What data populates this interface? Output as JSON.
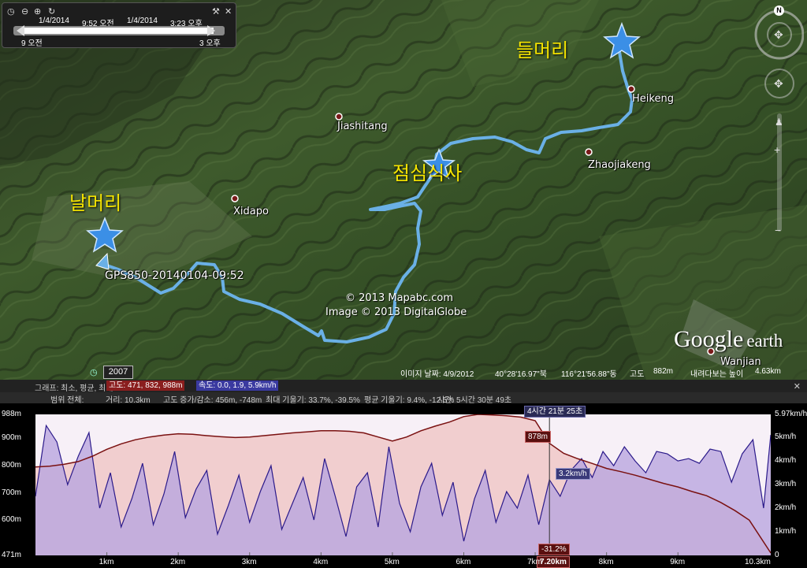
{
  "map": {
    "places": [
      "Jiashitang",
      "Heikeng",
      "Zhaojiakeng",
      "Xidapo",
      "Wanjian"
    ],
    "korean_labels": {
      "start": "날머리",
      "lunch": "점심식사",
      "end": "들머리"
    },
    "track_name": "GPS850-20140104-09:52",
    "copyright_1": "© 2013 Mapabc.com",
    "copyright_2": "Image © 2013 DigitalGlobe",
    "logo_google": "Google",
    "logo_earth": "earth",
    "compass_north": "N"
  },
  "timebar": {
    "start_date": "1/4/2014",
    "start_time": "9:52 오전",
    "end_date": "1/4/2014",
    "end_time": "3:23 오후",
    "left_label": "9 오전",
    "right_label": "3 오후"
  },
  "statusbar": {
    "year": "2007",
    "image_date": "이미지 날짜: 4/9/2012",
    "lat": "40°28'16.97\"북",
    "lon": "116°21'56.88\"동",
    "elev_label": "고도",
    "elev_value": "882m",
    "eye_label": "내려다보는 높이",
    "eye_value": "4.63km"
  },
  "profile": {
    "header1_label": "그래프: 최소, 평균, 최대",
    "header1_elev": "고도: 471, 832, 988m",
    "header1_speed": "속도: 0.0, 1.9, 5.9km/h",
    "header2_range": "범위 전체:",
    "header2_dist": "거리: 10.3km",
    "header2_gain": "고도 증가/감소: 456m, -748m",
    "header2_slope_max": "최대 기울기: 33.7%, -39.5%",
    "header2_slope_avg": "평균 기울기: 9.4%, -12.5%",
    "header2_time": "시간: 5시간 30분 49초",
    "cursor_time": "4시간 21분 25초",
    "cursor_elev": "878m",
    "cursor_speed": "3.2km/h",
    "cursor_slope": "-31.2%",
    "cursor_dist": "7.20km",
    "colors": {
      "elev_fill": "#f0c8c8",
      "speed_fill": "#b9a6df",
      "elev_line": "#7a1111",
      "speed_line": "#2b1a8a",
      "header_elev": "#8a1e1e",
      "header_speed": "#3a3aa0"
    }
  },
  "chart_data": {
    "type": "line",
    "title": "",
    "xlabel": "",
    "ylabel": "",
    "xlim": [
      0,
      10.3
    ],
    "y_left_lim": [
      471,
      988
    ],
    "y_right_lim": [
      0,
      5.97
    ],
    "x_ticks": [
      "1km",
      "2km",
      "3km",
      "4km",
      "5km",
      "6km",
      "7km",
      "8km",
      "9km",
      "10.3km"
    ],
    "y_left_ticks": [
      "988m",
      "900m",
      "800m",
      "700m",
      "600m",
      "471m"
    ],
    "y_right_ticks": [
      "5.97km/h",
      "5km/h",
      "4km/h",
      "3km/h",
      "2km/h",
      "1km/h",
      "0"
    ],
    "series": [
      {
        "axis": "left",
        "x": [
          0,
          0.2,
          0.4,
          0.6,
          0.8,
          1.0,
          1.2,
          1.4,
          1.6,
          1.8,
          2.0,
          2.2,
          2.4,
          2.6,
          2.8,
          3.0,
          3.2,
          3.4,
          3.6,
          3.8,
          4.0,
          4.2,
          4.4,
          4.6,
          4.8,
          5.0,
          5.2,
          5.4,
          5.6,
          5.8,
          6.0,
          6.2,
          6.4,
          6.6,
          6.8,
          7.0,
          7.2,
          7.4,
          7.6,
          7.8,
          8.0,
          8.2,
          8.4,
          8.6,
          8.8,
          9.0,
          9.2,
          9.4,
          9.6,
          9.8,
          10.0,
          10.3
        ],
        "values": [
          795,
          798,
          805,
          815,
          835,
          860,
          880,
          895,
          905,
          912,
          917,
          915,
          910,
          906,
          903,
          905,
          910,
          915,
          920,
          924,
          928,
          928,
          926,
          920,
          905,
          890,
          905,
          928,
          945,
          960,
          980,
          988,
          986,
          983,
          978,
          965,
          882,
          845,
          825,
          808,
          790,
          778,
          765,
          750,
          735,
          722,
          705,
          690,
          665,
          635,
          600,
          480
        ]
      },
      {
        "axis": "right",
        "x": [
          0,
          0.15,
          0.3,
          0.45,
          0.6,
          0.75,
          0.9,
          1.05,
          1.2,
          1.35,
          1.5,
          1.65,
          1.8,
          1.95,
          2.1,
          2.25,
          2.4,
          2.55,
          2.7,
          2.85,
          3.0,
          3.15,
          3.3,
          3.45,
          3.6,
          3.75,
          3.9,
          4.05,
          4.2,
          4.35,
          4.5,
          4.65,
          4.8,
          4.95,
          5.1,
          5.25,
          5.4,
          5.55,
          5.7,
          5.85,
          6.0,
          6.15,
          6.3,
          6.45,
          6.6,
          6.75,
          6.9,
          7.05,
          7.2,
          7.35,
          7.5,
          7.65,
          7.8,
          7.95,
          8.1,
          8.25,
          8.4,
          8.55,
          8.7,
          8.85,
          9.0,
          9.15,
          9.3,
          9.45,
          9.6,
          9.75,
          9.9,
          10.05,
          10.2,
          10.3
        ],
        "values": [
          2.5,
          5.5,
          4.8,
          3.0,
          4.2,
          5.2,
          2.0,
          3.5,
          1.2,
          2.4,
          3.9,
          1.3,
          2.6,
          4.4,
          1.6,
          2.8,
          3.6,
          0.9,
          2.1,
          3.4,
          1.4,
          2.7,
          3.8,
          1.1,
          2.2,
          3.3,
          1.5,
          4.1,
          2.5,
          0.8,
          2.9,
          3.5,
          1.2,
          4.6,
          2.2,
          1.0,
          2.9,
          3.9,
          1.7,
          3.1,
          0.6,
          2.4,
          3.6,
          1.4,
          2.7,
          2.0,
          3.4,
          1.3,
          3.2,
          2.5,
          3.6,
          4.1,
          3.3,
          4.4,
          3.8,
          4.6,
          4.0,
          3.5,
          4.4,
          4.3,
          4.0,
          4.1,
          3.9,
          4.5,
          4.4,
          3.1,
          4.3,
          4.9,
          2.0,
          5.1
        ]
      }
    ]
  }
}
